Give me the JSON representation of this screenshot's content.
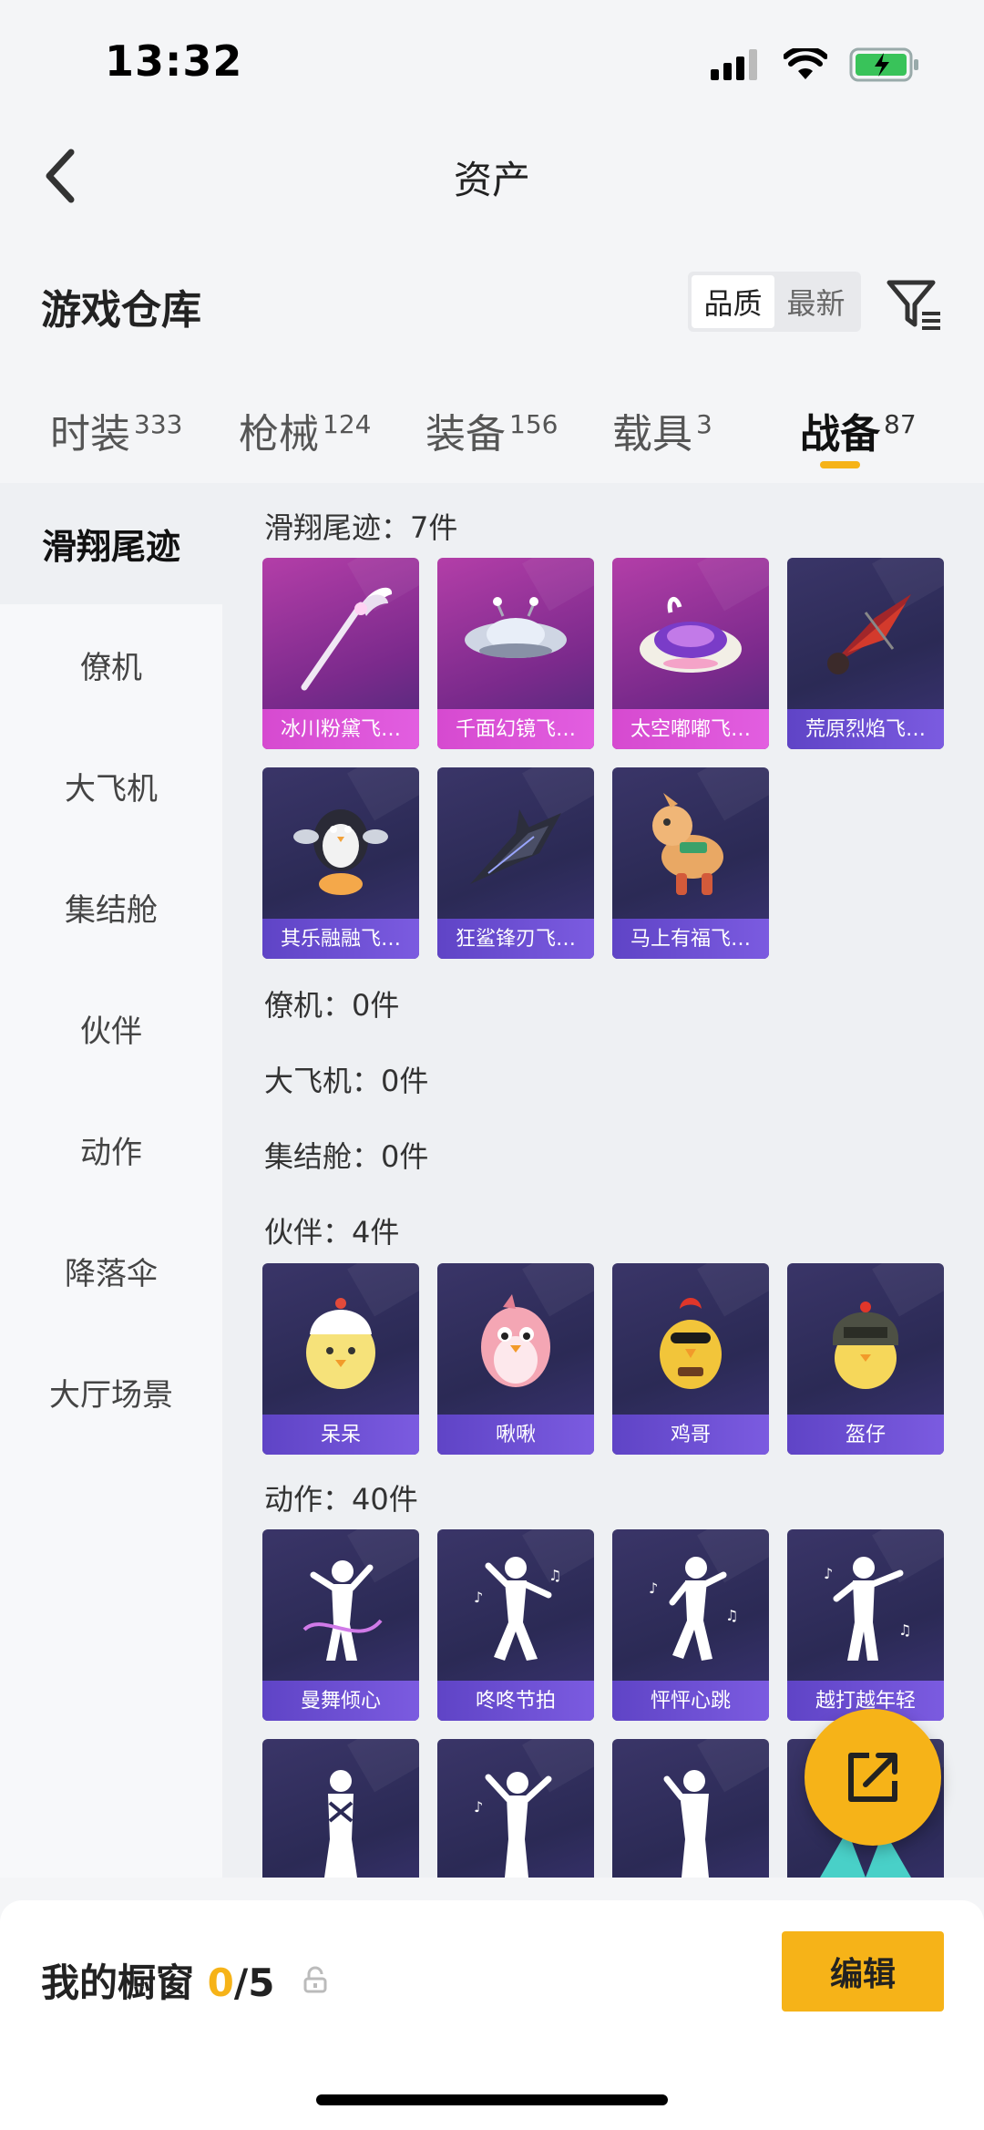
{
  "status": {
    "time": "13:32"
  },
  "nav": {
    "title": "资产",
    "back_icon": "chevron-left-icon"
  },
  "warehouse": {
    "title": "游戏仓库",
    "sort_options": [
      "品质",
      "最新"
    ],
    "sort_selected": "品质",
    "filter_icon": "filter-icon"
  },
  "tabs": [
    {
      "label": "时装",
      "count": "333"
    },
    {
      "label": "枪械",
      "count": "124"
    },
    {
      "label": "装备",
      "count": "156"
    },
    {
      "label": "载具",
      "count": "3"
    },
    {
      "label": "战备",
      "count": "87"
    }
  ],
  "active_tab": "战备",
  "sidebar": {
    "items": [
      "滑翔尾迹",
      "僚机",
      "大飞机",
      "集结舱",
      "伙伴",
      "动作",
      "降落伞",
      "大厅场景"
    ],
    "active": "滑翔尾迹"
  },
  "sections": {
    "glide": {
      "title": "滑翔尾迹：7件",
      "items": [
        "冰川粉黛飞…",
        "千面幻镜飞…",
        "太空嘟嘟飞…",
        "荒原烈焰飞…",
        "其乐融融飞…",
        "狂鲨锋刃飞…",
        "马上有福飞…"
      ]
    },
    "wingman": {
      "title": "僚机：0件"
    },
    "plane": {
      "title": "大飞机：0件"
    },
    "pod": {
      "title": "集结舱：0件"
    },
    "partner": {
      "title": "伙伴：4件",
      "items": [
        "呆呆",
        "啾啾",
        "鸡哥",
        "盔仔"
      ]
    },
    "emote": {
      "title": "动作：40件",
      "items": [
        "曼舞倾心",
        "咚咚节拍",
        "怦怦心跳",
        "越打越年轻"
      ]
    }
  },
  "bottom": {
    "showcase_label": "我的橱窗",
    "showcase_used": "0",
    "showcase_total": "/5",
    "edit_label": "编辑"
  },
  "colors": {
    "accent": "#f6b318",
    "card_purple": "#2b2a55",
    "card_pink": "#b33ea8"
  }
}
